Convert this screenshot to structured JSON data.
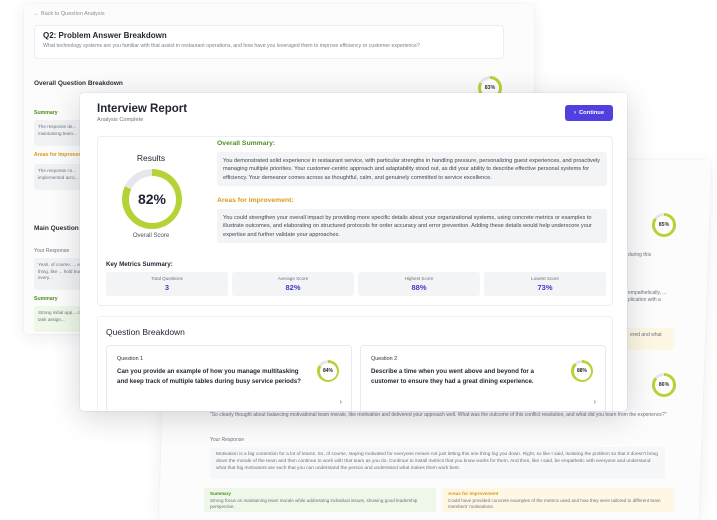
{
  "background": {
    "back_link": "← Back to Question Analysis",
    "question_title": "Q2: Problem Answer Breakdown",
    "question_subtitle": "What technology systems are you familiar with that assist in restaurant operations, and how have you leveraged them to improve efficiency or customer experience?",
    "overall_breakdown": "Overall Question Breakdown",
    "overall_score": "83%",
    "summary_label": "Summary",
    "summary_snip": "The response de... maintaining team...",
    "improve_label": "Areas for Improvem...",
    "improve_snip": "The response co... implemented acro...",
    "main_question": "Main Question",
    "your_response": "Your Response",
    "response_snip": "Yeah, of course, ... even thing, like ... hold true to every...",
    "summary_label2": "Summary",
    "summary_snip2": "Strong initial app... clear task assign...",
    "right_score_1": "85%",
    "right_score_2": "86%",
    "right_snip_1": "during this",
    "right_snip_2": "empathetically, ... plication with a",
    "right_snip_3": "ered and what",
    "right_top_q": "\"So clearly thought about balancing motivational team morale, like motivation and delivered your approach well. What was the outcome of this conflict resolution, and what did you learn from the experience?\"",
    "right_response_label": "Your Response",
    "right_response": "Motivation is a big contention for a lot of teams. So, of course, staying motivated for everyone means not just letting this one thing log you down. Right, so like I said, isolating the problem so that it doesn't bring down the morale of the team and then continue to work with that team as you do. Continue to install metrics that you know works for them. And then, like I said, be empathetic with everyone and understand what that big motivators are such that you can understand the person and understand what makes them work best.",
    "right_summary_label": "Summary",
    "right_summary": "Strong focus on maintaining team morale while addressing individual issues, showing good leadership perspective.",
    "right_improve_label": "Areas for Improvement",
    "right_improve": "Could have provided concrete examples of the metrics used and how they were tailored to different team members' motivations."
  },
  "header": {
    "title": "Interview Report",
    "subtitle": "Analysis Complete",
    "continue_label": "Continue"
  },
  "results": {
    "heading": "Results",
    "score": 82,
    "score_text": "82%",
    "score_label": "Overall Score"
  },
  "summary": {
    "title": "Overall Summary:",
    "text": "You demonstrated solid experience in restaurant service, with particular strengths in handling pressure, personalizing guest experiences, and proactively managing multiple priorities. Your customer-centric approach and adaptability stood out, as did your ability to describe effective personal systems for efficiency. Your demeanor comes across as thoughtful, calm, and genuinely committed to service excellence."
  },
  "improvement": {
    "title": "Areas for Improvement:",
    "text": "You could strengthen your overall impact by providing more specific details about your organizational systems, using concrete metrics or examples to illustrate outcomes, and elaborating on structured protocols for order accuracy and error prevention. Adding these details would help underscore your expertise and further validate your approaches."
  },
  "metrics": {
    "title": "Key Metrics Summary:",
    "items": [
      {
        "label": "Total Questions",
        "value": "3"
      },
      {
        "label": "Average Score",
        "value": "82%"
      },
      {
        "label": "Highest Score",
        "value": "88%"
      },
      {
        "label": "Lowest Score",
        "value": "73%"
      }
    ]
  },
  "breakdown": {
    "title": "Question Breakdown",
    "questions": [
      {
        "number": "Question 1",
        "text": "Can you provide an example of how you manage multitasking and keep track of multiple tables during busy service periods?",
        "score": 84,
        "score_text": "84%"
      },
      {
        "number": "Question 2",
        "text": "Describe a time when you went above and beyond for a customer to ensure they had a great dining experience.",
        "score": 88,
        "score_text": "88%"
      }
    ]
  },
  "colors": {
    "accent": "#5140e0",
    "score_ring": "#b5d337",
    "summary_title": "#4f8f1f",
    "improvement_title": "#d99a1a",
    "metric_value": "#4338ca"
  }
}
